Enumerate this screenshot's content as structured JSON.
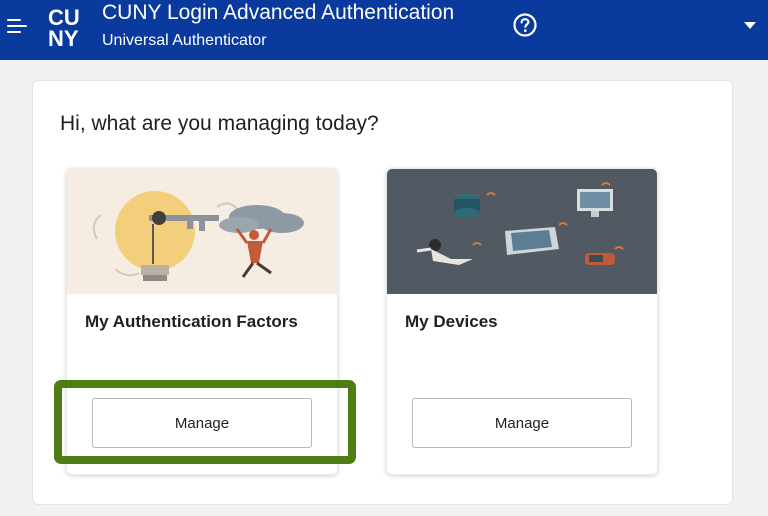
{
  "header": {
    "title": "CUNY Login Advanced Authentication",
    "subtitle": "Universal Authenticator",
    "logo_text_top": "CU",
    "logo_text_bottom": "NY",
    "icons": {
      "menu": "hamburger-menu-icon",
      "help": "question-circle-icon",
      "user_menu": "caret-down-icon"
    },
    "background_color": "#0a3a9e"
  },
  "main": {
    "greeting": "Hi, what are you managing today?",
    "cards": [
      {
        "title": "My Authentication Factors",
        "button_label": "Manage",
        "image": "lightbulb-key-cloud-illustration"
      },
      {
        "title": "My Devices",
        "button_label": "Manage",
        "image": "connected-devices-illustration"
      }
    ]
  },
  "highlight": {
    "color": "#4e7d16",
    "target": "first-card-manage-button"
  }
}
